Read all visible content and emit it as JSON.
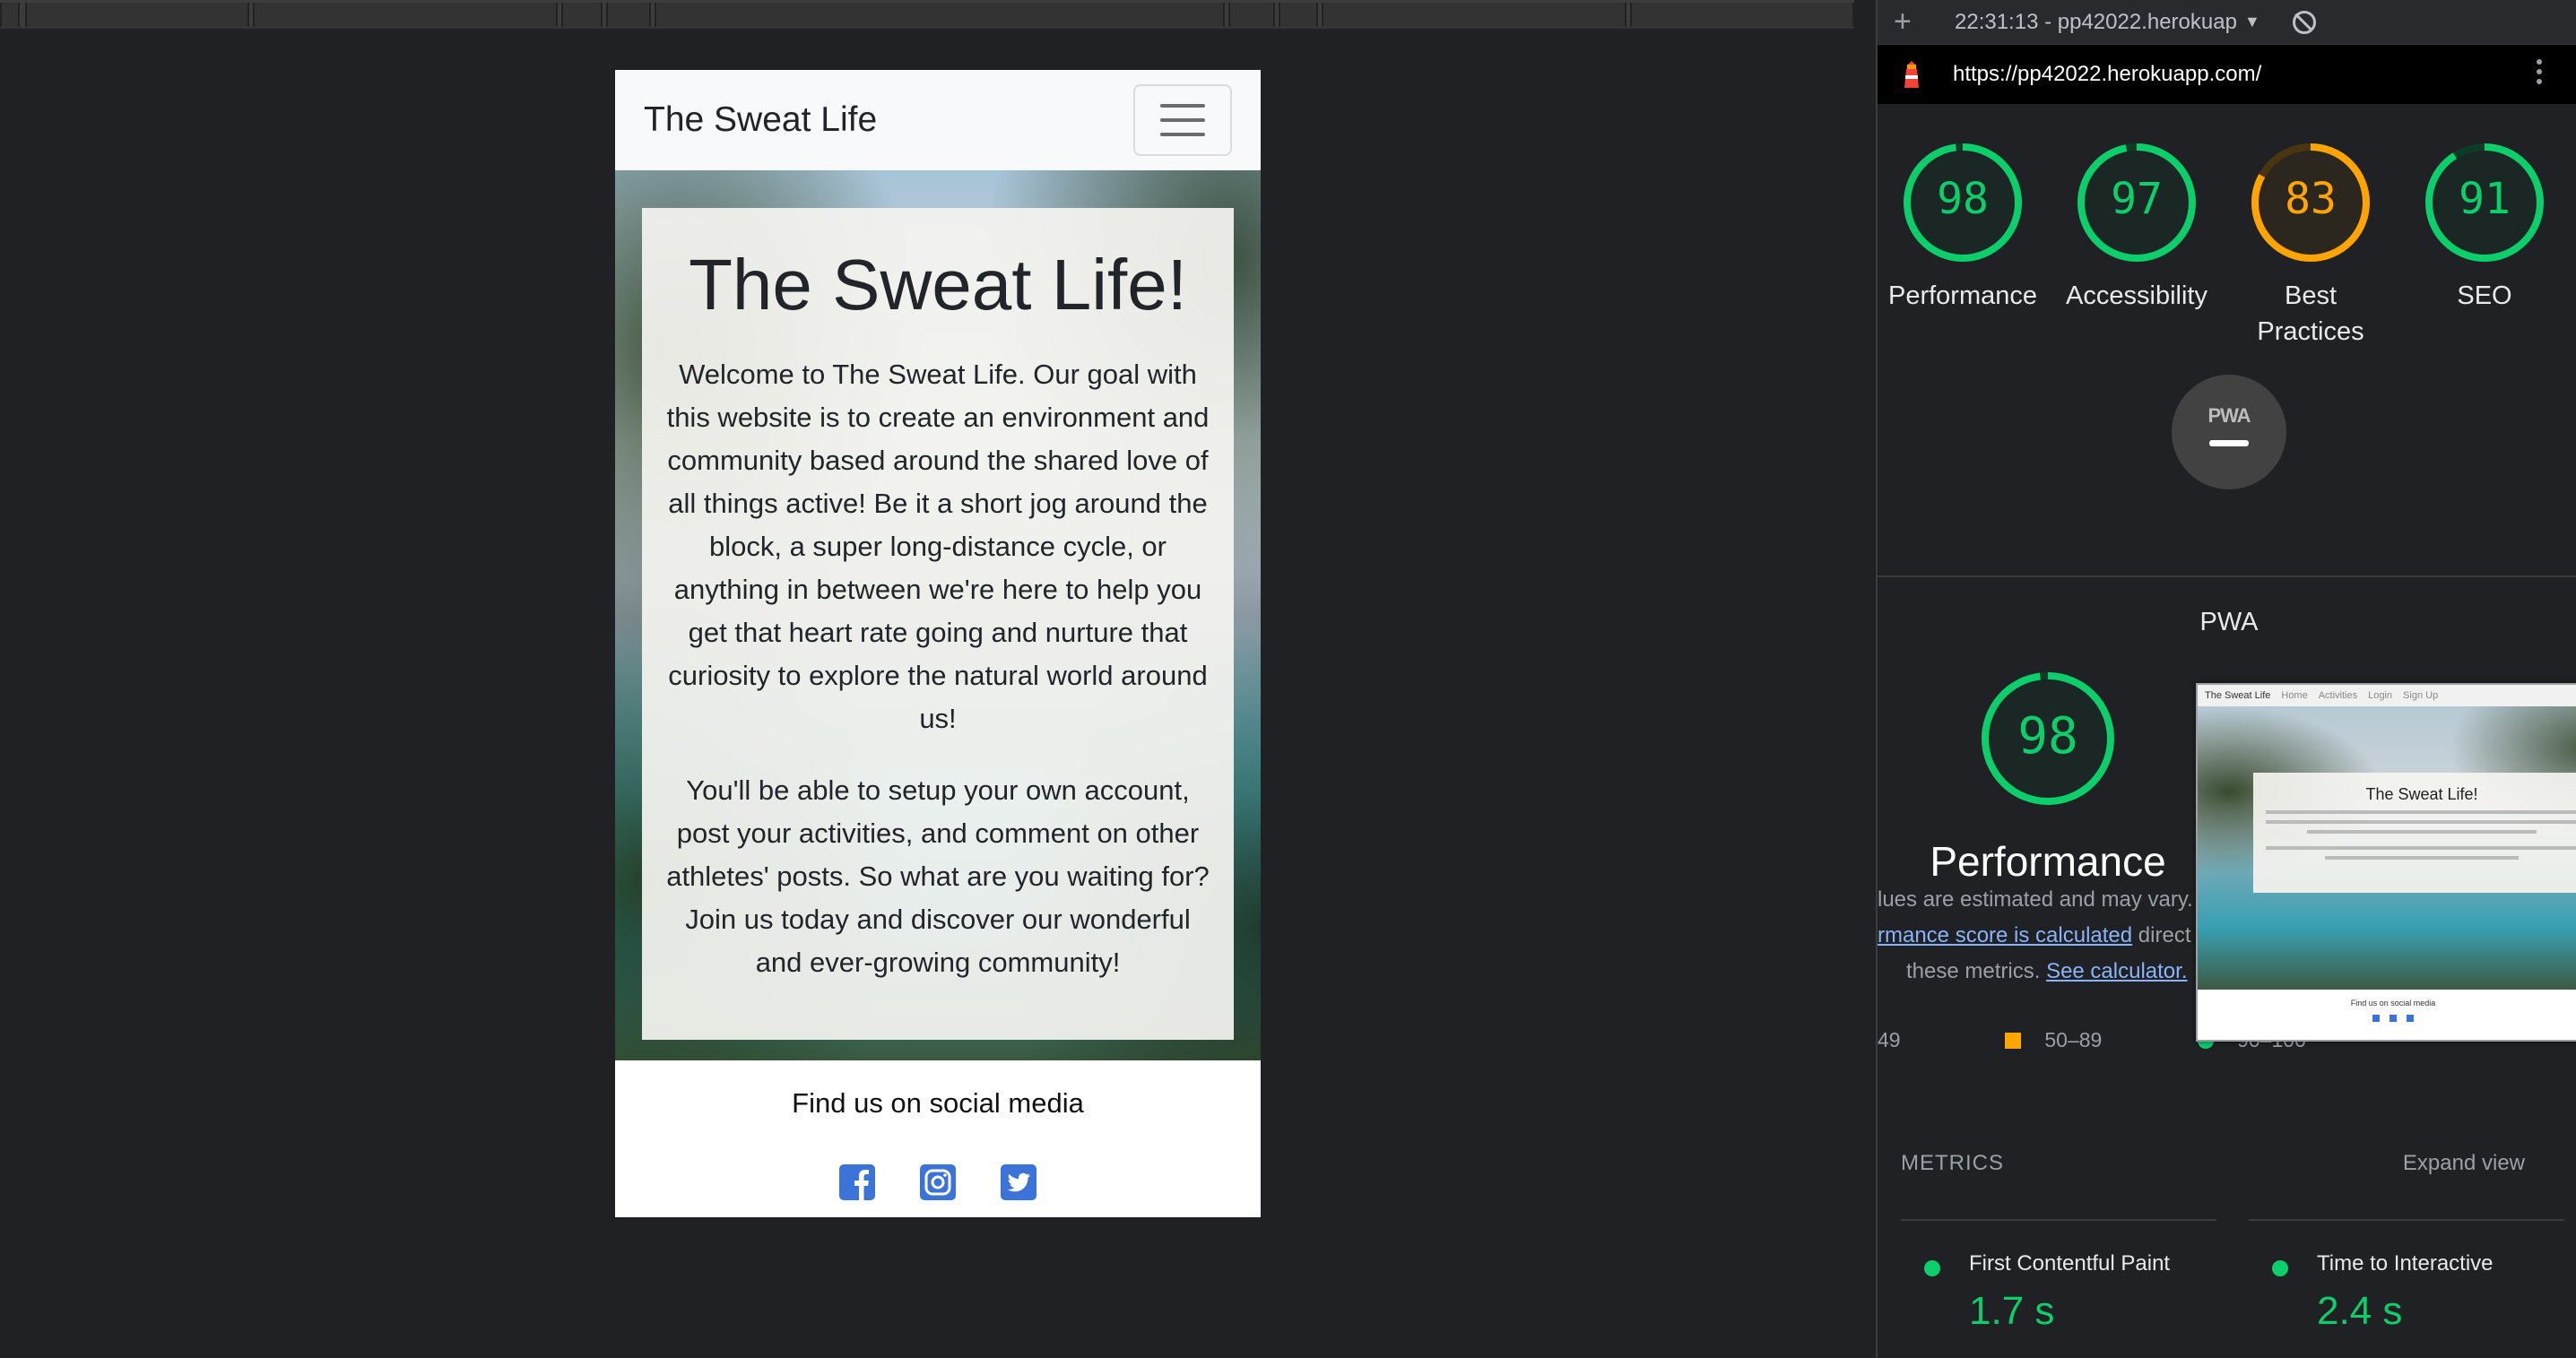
{
  "site": {
    "brand": "The Sweat Life",
    "hero_title": "The Sweat Life!",
    "hero_paragraph_1": "Welcome to The Sweat Life. Our goal with this website is to create an environment and community based around the shared love of all things active! Be it a short jog around the block, a super long-distance cycle, or anything in between we're here to help you get that heart rate going and nurture that curiosity to explore the natural world around us!",
    "hero_paragraph_2": "You'll be able to setup your own account, post your activities, and comment on other athletes' posts. So what are you waiting for? Join us today and discover our wonderful and ever-growing community!",
    "footer_title": "Find us on social media",
    "social_icons": [
      "facebook-icon",
      "instagram-icon",
      "twitter-icon"
    ],
    "social_color": "#3b73d9"
  },
  "lighthouse": {
    "report_time": "22:31:13 - pp42022.herokuap",
    "url": "https://pp42022.herokuapp.com/",
    "scores": [
      {
        "value": "98",
        "label": "Performance",
        "color": "#0cce6b",
        "fraction": 0.98
      },
      {
        "value": "97",
        "label": "Accessibility",
        "color": "#0cce6b",
        "fraction": 0.97
      },
      {
        "value": "83",
        "label_line1": "Best",
        "label_line2": "Practices",
        "color": "#ffa400",
        "fraction": 0.83
      },
      {
        "value": "91",
        "label": "SEO",
        "color": "#0cce6b",
        "fraction": 0.91
      }
    ],
    "pwa": {
      "logo": "PWA",
      "label": "PWA"
    },
    "performance": {
      "score": "98",
      "fraction": 0.98,
      "title": "Performance",
      "note_1": "lues are estimated and may vary.",
      "note_2_link": "rmance score is calculated",
      "note_2_tail": " direct",
      "note_3": "these metrics.",
      "note_3_link": "See calculator.",
      "legend_low": "49",
      "legend_mid": "50–89",
      "legend_high": "90–100"
    },
    "screenshot": {
      "nav_brand": "The Sweat Life",
      "nav_items": [
        "Home",
        "Activities",
        "Login",
        "Sign Up"
      ],
      "title": "The Sweat Life!",
      "footer": "Find us on social media"
    },
    "metrics": {
      "title": "METRICS",
      "expand": "Expand view",
      "items": [
        {
          "name": "First Contentful Paint",
          "value": "1.7 s"
        },
        {
          "name": "Time to Interactive",
          "value": "2.4 s"
        }
      ]
    }
  }
}
